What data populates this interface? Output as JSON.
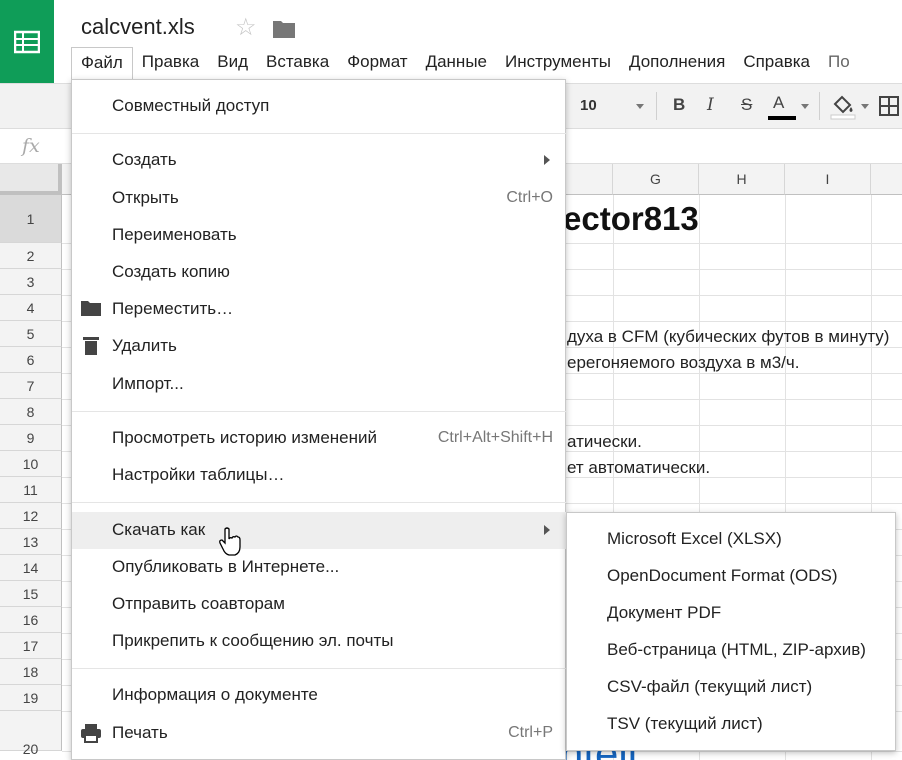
{
  "app": {
    "doc_title": "calcvent.xls",
    "brand_color": "#0f9d58",
    "icons": [
      "sheets-logo-icon",
      "star-icon",
      "folder-icon"
    ]
  },
  "menubar": {
    "items": [
      "Файл",
      "Правка",
      "Вид",
      "Вставка",
      "Формат",
      "Данные",
      "Инструменты",
      "Дополнения",
      "Справка",
      "По"
    ],
    "active": "Файл"
  },
  "toolbar": {
    "font_size": "10",
    "bold": "B",
    "italic": "I",
    "strike": "S",
    "text_color": "A"
  },
  "formula_bar": {
    "fx": "fx"
  },
  "columns": [
    "G",
    "H",
    "I"
  ],
  "rows": [
    "1",
    "2",
    "3",
    "4",
    "5",
    "6",
    "7",
    "8",
    "9",
    "10",
    "11",
    "12",
    "13",
    "14",
    "15",
    "16",
    "17",
    "18",
    "19",
    "20"
  ],
  "cells": {
    "big_title": "ector813",
    "row5": "духа в CFM (кубических футов в минуту)",
    "row6": "ерегоняемого воздуха в м3/ч.",
    "row9": "атически.",
    "row10": "ет автоматически.",
    "row20": "ntell"
  },
  "file_menu": {
    "share": "Совместный доступ",
    "new": "Создать",
    "open": "Открыть",
    "open_shortcut": "Ctrl+O",
    "rename": "Переименовать",
    "copy": "Создать копию",
    "move": "Переместить…",
    "delete": "Удалить",
    "import": "Импорт...",
    "history": "Просмотреть историю изменений",
    "history_shortcut": "Ctrl+Alt+Shift+H",
    "settings": "Настройки таблицы…",
    "download": "Скачать как",
    "publish": "Опубликовать в Интернете...",
    "email_collab": "Отправить соавторам",
    "email_attach": "Прикрепить к сообщению эл. почты",
    "info": "Информация о документе",
    "print": "Печать",
    "print_shortcut": "Ctrl+P"
  },
  "download_submenu": {
    "xlsx": "Microsoft Excel (XLSX)",
    "ods": "OpenDocument Format (ODS)",
    "pdf": "Документ PDF",
    "html": "Веб-страница (HTML, ZIP-архив)",
    "csv": "CSV-файл (текущий лист)",
    "tsv": "TSV (текущий лист)"
  }
}
